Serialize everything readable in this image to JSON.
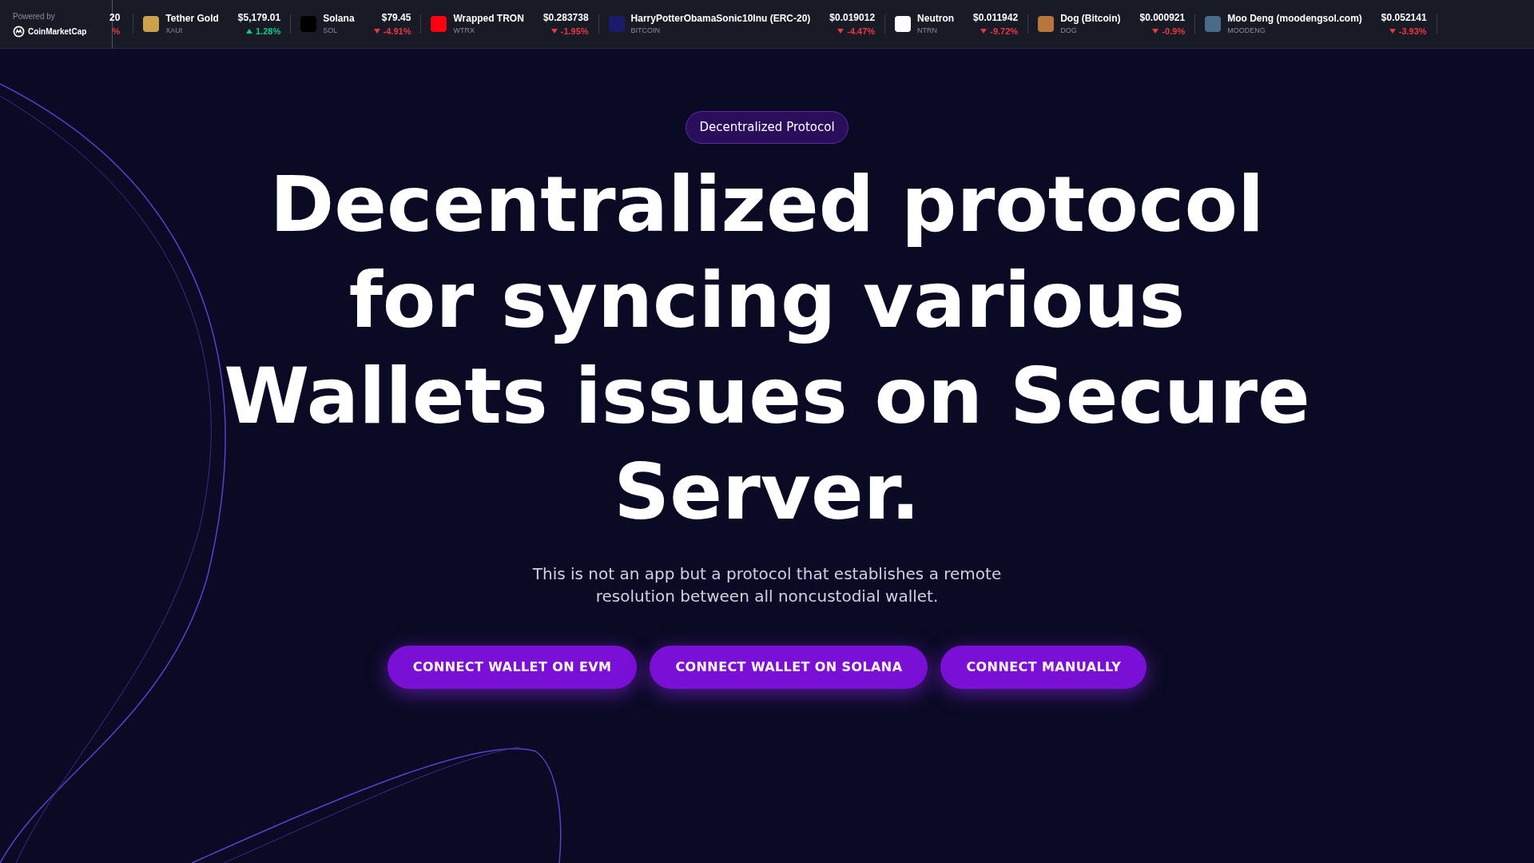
{
  "ticker": {
    "powered_by": "Powered by",
    "brand": "CoinMarketCap",
    "items": [
      {
        "kind": "partial",
        "price": "20",
        "change": "%",
        "rising": false
      },
      {
        "kind": "full",
        "name": "Tether Gold",
        "symbol": "XAUt",
        "price": "$5,179.01",
        "change": "1.28%",
        "rising": true,
        "color": "#c9a24a"
      },
      {
        "kind": "full",
        "name": "Solana",
        "symbol": "SOL",
        "price": "$79.45",
        "change": "-4.91%",
        "rising": false,
        "color": "#000000"
      },
      {
        "kind": "full",
        "name": "Wrapped TRON",
        "symbol": "WTRX",
        "price": "$0.283738",
        "change": "-1.95%",
        "rising": false,
        "color": "#ff0013"
      },
      {
        "kind": "full",
        "name": "HarryPotterObamaSonic10Inu (ERC-20)",
        "symbol": "BITCOIN",
        "price": "$0.019012",
        "change": "-4.47%",
        "rising": false,
        "color": "#1b1b6b"
      },
      {
        "kind": "full",
        "name": "Neutron",
        "symbol": "NTRN",
        "price": "$0.011942",
        "change": "-9.72%",
        "rising": false,
        "color": "#ffffff"
      },
      {
        "kind": "full",
        "name": "Dog (Bitcoin)",
        "symbol": "DOG",
        "price": "$0.000921",
        "change": "-0.9%",
        "rising": false,
        "color": "#b8763a"
      },
      {
        "kind": "full",
        "name": "Moo Deng (moodengsol.com)",
        "symbol": "MOODENG",
        "price": "$0.052141",
        "change": "-3.93%",
        "rising": false,
        "color": "#4a6a8a"
      }
    ]
  },
  "hero": {
    "badge": "Decentralized Protocol",
    "title_lines": [
      "Decentralized protocol",
      "for syncing various",
      "Wallets issues on Secure",
      "Server."
    ],
    "subtitle_lines": [
      "This is not an app but a protocol that establishes a remote",
      "resolution between all noncustodial wallet."
    ],
    "buttons": [
      "CONNECT WALLET ON EVM",
      "CONNECT WALLET ON SOLANA",
      "CONNECT MANUALLY"
    ]
  }
}
